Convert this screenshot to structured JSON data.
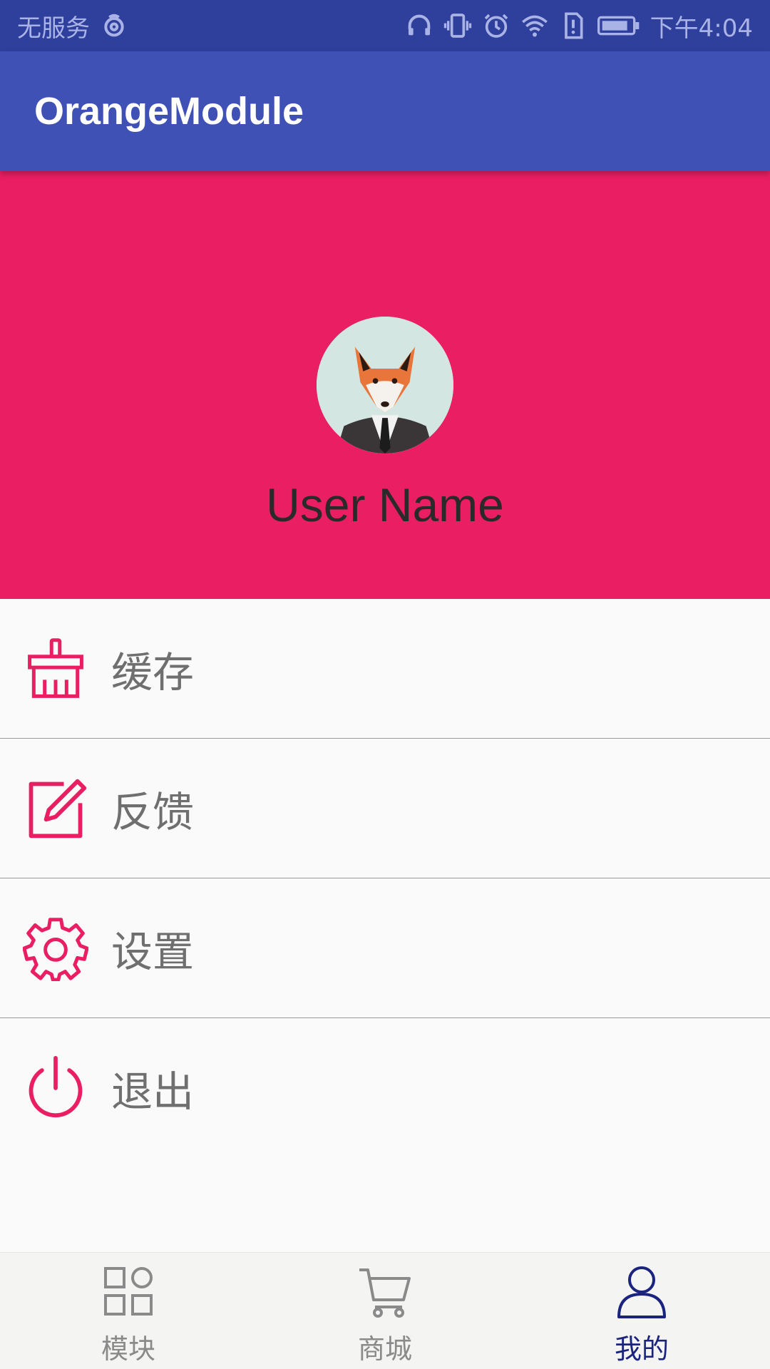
{
  "status_bar": {
    "carrier": "无服务",
    "time": "下午4:04",
    "icons": [
      "hotspot-icon",
      "headset-icon",
      "vibrate-icon",
      "alarm-icon",
      "wifi-icon",
      "sim-alert-icon",
      "battery-icon"
    ]
  },
  "app_bar": {
    "title": "OrangeModule"
  },
  "profile": {
    "user_name": "User Name",
    "avatar_icon": "fox-avatar"
  },
  "menu": [
    {
      "label": "缓存",
      "icon": "broom-icon"
    },
    {
      "label": "反馈",
      "icon": "edit-icon"
    },
    {
      "label": "设置",
      "icon": "gear-icon"
    },
    {
      "label": "退出",
      "icon": "power-icon"
    }
  ],
  "bottom_nav": [
    {
      "label": "模块",
      "icon": "grid-icon",
      "active": false
    },
    {
      "label": "商城",
      "icon": "cart-icon",
      "active": false
    },
    {
      "label": "我的",
      "icon": "person-icon",
      "active": true
    }
  ],
  "colors": {
    "status_bar": "#2f3f9c",
    "app_bar": "#3f51b5",
    "accent": "#e91e63",
    "nav_active": "#1a237e",
    "nav_inactive": "#8a8a8a"
  }
}
